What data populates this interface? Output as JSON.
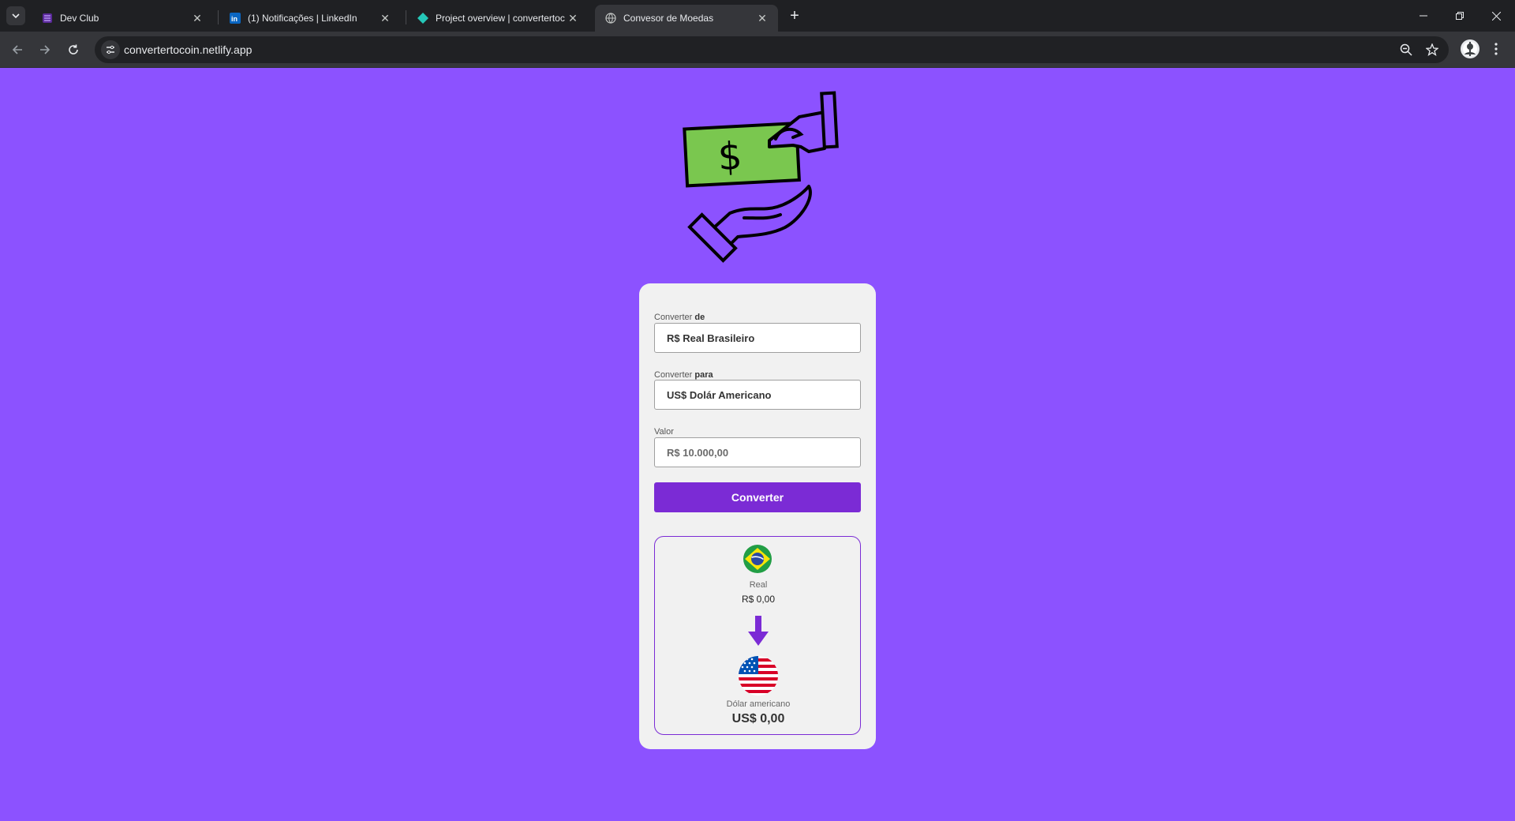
{
  "browser": {
    "tabs": [
      {
        "title": "Dev Club",
        "favicon": "devclub-icon"
      },
      {
        "title": "(1) Notificações | LinkedIn",
        "favicon": "linkedin-icon"
      },
      {
        "title": "Project overview | convertertoc",
        "favicon": "netlify-icon"
      },
      {
        "title": "Convesor de Moedas",
        "favicon": "globe-icon",
        "active": true
      }
    ],
    "url": "convertertocoin.netlify.app"
  },
  "converter": {
    "from_label_prefix": "Converter ",
    "from_label_bold": "de",
    "from_value": "R$ Real Brasileiro",
    "to_label_prefix": "Converter ",
    "to_label_bold": "para",
    "to_value": "US$ Dolár Americano",
    "amount_label": "Valor",
    "amount_placeholder": "R$ 10.000,00",
    "button_label": "Converter"
  },
  "result": {
    "from_currency_name": "Real",
    "from_currency_value": "R$ 0,00",
    "to_currency_name": "Dólar americano",
    "to_currency_value": "US$ 0,00"
  },
  "colors": {
    "page_background": "#8c52ff",
    "accent": "#7b2bd5",
    "money_green": "#7ac74f"
  }
}
